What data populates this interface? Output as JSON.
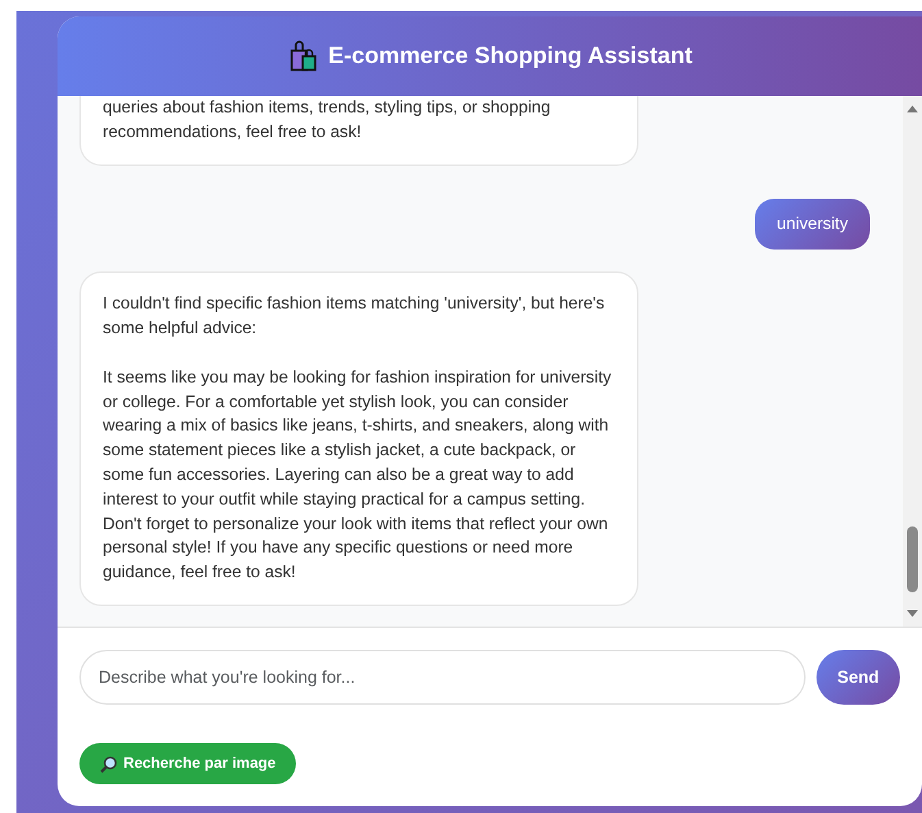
{
  "header": {
    "title": "E-commerce Shopping Assistant"
  },
  "messages": [
    {
      "kind": "partial",
      "paragraphs": [
        "queries about fashion items, trends, styling tips, or shopping recommendations, feel free to ask!"
      ]
    },
    {
      "kind": "user",
      "paragraphs": [
        "university"
      ]
    },
    {
      "kind": "reply",
      "paragraphs": [
        "I couldn't find specific fashion items matching 'university', but here's some helpful advice:",
        "It seems like you may be looking for fashion inspiration for university or college. For a comfortable yet stylish look, you can consider wearing a mix of basics like jeans, t-shirts, and sneakers, along with some statement pieces like a stylish jacket, a cute backpack, or some fun accessories. Layering can also be a great way to add interest to your outfit while staying practical for a campus setting. Don't forget to personalize your look with items that reflect your own personal style! If you have any specific questions or need more guidance, feel free to ask!"
      ]
    }
  ],
  "input": {
    "placeholder": "Describe what you're looking for..."
  },
  "send_button": "Send",
  "image_search_button": "Recherche par image"
}
